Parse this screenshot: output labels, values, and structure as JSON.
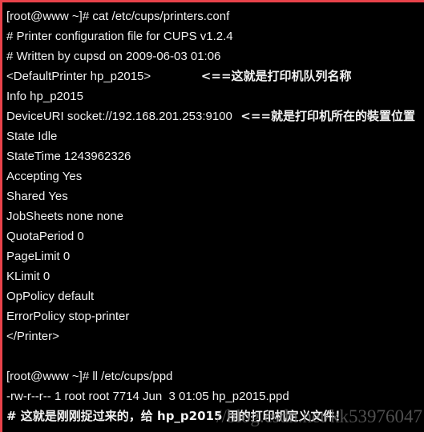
{
  "window": {
    "background_color": "#000000",
    "text_color": "#f2f2f2",
    "border_color": "#e8424a"
  },
  "terminal": {
    "lines": [
      {
        "text": "[root@www ~]# cat /etc/cups/printers.conf"
      },
      {
        "text": "# Printer configuration file for CUPS v1.2.4"
      },
      {
        "text": "# Written by cupsd on 2009-06-03 01:06"
      },
      {
        "text": "<DefaultPrinter hp_p2015>",
        "annotation": "            <==这就是打印机队列名称"
      },
      {
        "text": "Info hp_p2015"
      },
      {
        "text": "DeviceURI socket://192.168.201.253:9100",
        "annotation": "  <==就是打印机所在的裝置位置"
      },
      {
        "text": "State Idle"
      },
      {
        "text": "StateTime 1243962326"
      },
      {
        "text": "Accepting Yes"
      },
      {
        "text": "Shared Yes"
      },
      {
        "text": "JobSheets none none"
      },
      {
        "text": "QuotaPeriod 0"
      },
      {
        "text": "PageLimit 0"
      },
      {
        "text": "KLimit 0"
      },
      {
        "text": "OpPolicy default"
      },
      {
        "text": "ErrorPolicy stop-printer"
      },
      {
        "text": "</Printer>"
      },
      {
        "text": ""
      },
      {
        "text": "[root@www ~]# ll /etc/cups/ppd"
      },
      {
        "text": "-rw-r--r-- 1 root root 7714 Jun  3 01:05 hp_p2015.ppd"
      },
      {
        "text": "# 这就是刚刚捉过来的，给 hp_p2015 用的打印机定义文件！"
      }
    ]
  },
  "watermark": {
    "text": "//blog.csdn.net/kk53976047",
    "color": "#6a6a6a"
  }
}
